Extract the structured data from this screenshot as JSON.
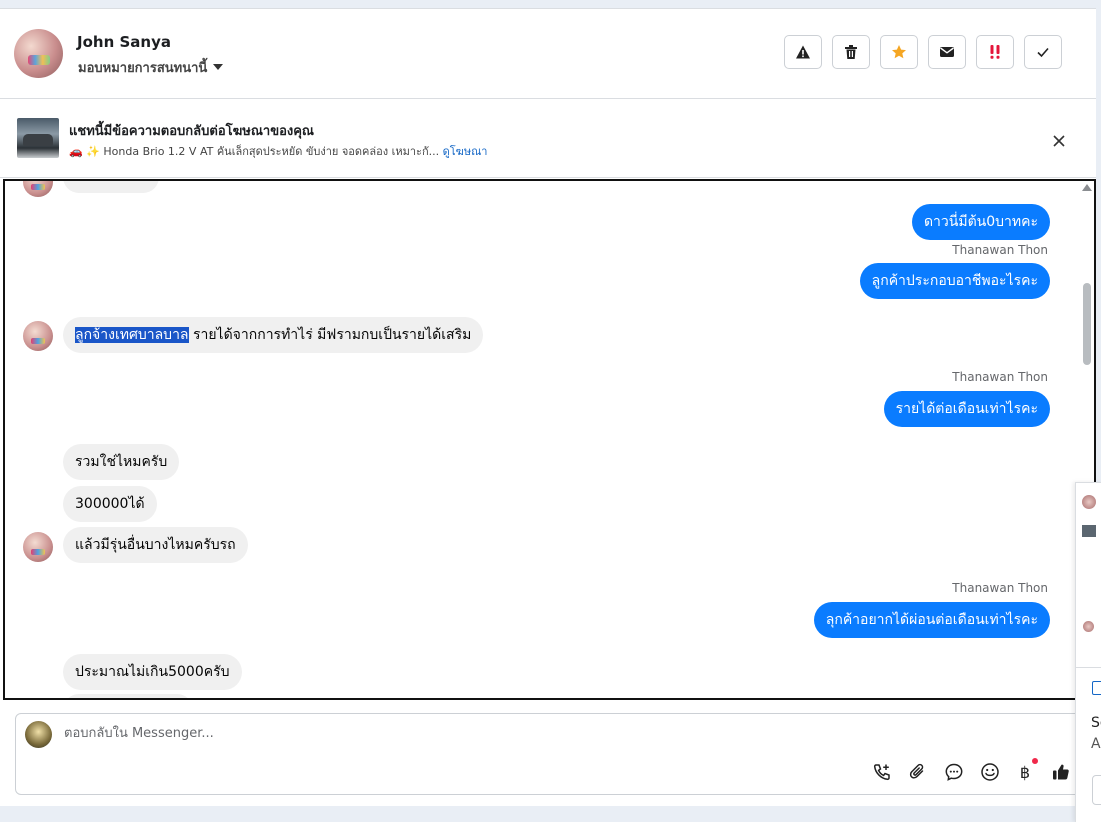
{
  "header": {
    "contact_name": "John Sanya",
    "assign_label": "มอบหมายการสนทนานี้"
  },
  "toolbar": {
    "buttons": [
      "alert-icon",
      "trash-icon",
      "star-icon",
      "envelope-icon",
      "exclamation-icon",
      "check-icon"
    ],
    "colors": {
      "star": "#f5a623",
      "exclamation": "#e4163a"
    }
  },
  "ad_banner": {
    "title": "แชทนี้มีข้อความตอบกลับต่อโฆษณาของคุณ",
    "description": "🚗 ✨ Honda Brio 1.2 V AT คันเล็กสุดประหยัด ขับง่าย จอดคล่อง เหมาะกั...",
    "link": "ดูโฆษณา"
  },
  "messages": {
    "out_1": "ดาวนี่มีต้น0บาทคะ",
    "sender_1": "Thanawan Thon",
    "out_2": "ลูกค้าประกอบอาชีพอะไรคะ",
    "in_1_highlight": "ลูกจ้างเทศบาลบาล",
    "in_1_rest": " รายได้จากการทำไร่ มีฟรามกบเป็นรายได้เสริม",
    "sender_2": "Thanawan Thon",
    "out_3": "รายได้ต่อเดือนเท่าไรคะ",
    "in_2": "รวมใช่ไหมครับ",
    "in_3": "300000ได้",
    "in_4": "แล้วมีรุ่นอื่นบางไหมครับรถ",
    "sender_3": "Thanawan Thon",
    "out_4": "ลุกค้าอยากได้ผ่อนต่อเดือนเท่าไรคะ",
    "in_5": "ประมาณไม่เกิน5000ครับ"
  },
  "composer": {
    "placeholder": "ตอบกลับใน Messenger...",
    "currency_symbol": "฿"
  },
  "right_panel": {
    "text_1": "Sc",
    "text_2": "A"
  }
}
